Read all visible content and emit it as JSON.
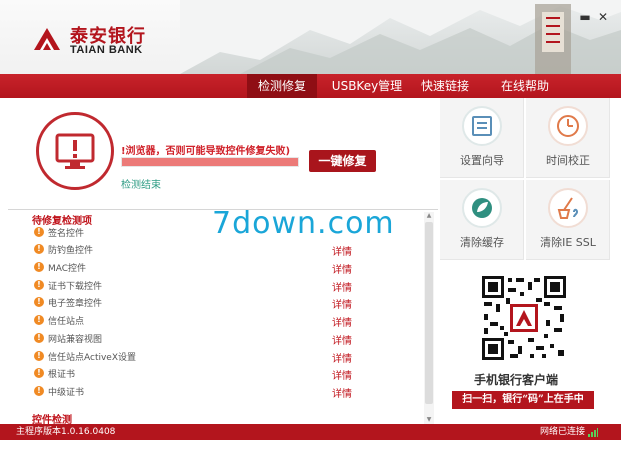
{
  "app": {
    "logo_cn": "泰安银行",
    "logo_en": "TAIAN BANK",
    "minimize_glyph": "▬",
    "close_glyph": "✕"
  },
  "nav": {
    "items": [
      {
        "label": "检测修复",
        "active": true
      },
      {
        "label": "USBKey管理",
        "active": false
      },
      {
        "label": "快速链接",
        "active": false
      },
      {
        "label": "在线帮助",
        "active": false
      }
    ]
  },
  "status": {
    "warning_text": "!浏览器，否则可能导致控件修复失败)",
    "progress_fraction": 1.0,
    "detail_text": "检测结束",
    "repair_button": "一键修复",
    "icon": "monitor-alert-icon"
  },
  "checklist": {
    "pending_header": "待修复检测项",
    "detail_label": "详情",
    "items": [
      {
        "label": "签名控件",
        "has_detail": false
      },
      {
        "label": "防钓鱼控件",
        "has_detail": true
      },
      {
        "label": "MAC控件",
        "has_detail": true
      },
      {
        "label": "证书下载控件",
        "has_detail": true
      },
      {
        "label": "电子签章控件",
        "has_detail": true
      },
      {
        "label": "信任站点",
        "has_detail": true
      },
      {
        "label": "网站兼容视图",
        "has_detail": true
      },
      {
        "label": "信任站点ActiveX设置",
        "has_detail": true
      },
      {
        "label": "根证书",
        "has_detail": true
      },
      {
        "label": "中级证书",
        "has_detail": true
      }
    ],
    "control_header": "控件检测"
  },
  "tools": [
    {
      "label": "设置向导",
      "icon": "setup-wizard-icon"
    },
    {
      "label": "时间校正",
      "icon": "clock-icon"
    },
    {
      "label": "清除缓存",
      "icon": "leaf-icon"
    },
    {
      "label": "清除IE SSL",
      "icon": "broom-icon"
    }
  ],
  "promo": {
    "title": "手机银行客户端",
    "banner": "扫一扫，银行“码”上在手中"
  },
  "watermark": "7down.com",
  "footer": {
    "version": "主程序版本1.0.16.0408",
    "network": "网络已连接"
  },
  "colors": {
    "brand_red": "#b3151d",
    "detail_green": "#2e9c84",
    "warning_orange": "#f08a24",
    "watermark_blue": "#1aa6d8"
  }
}
